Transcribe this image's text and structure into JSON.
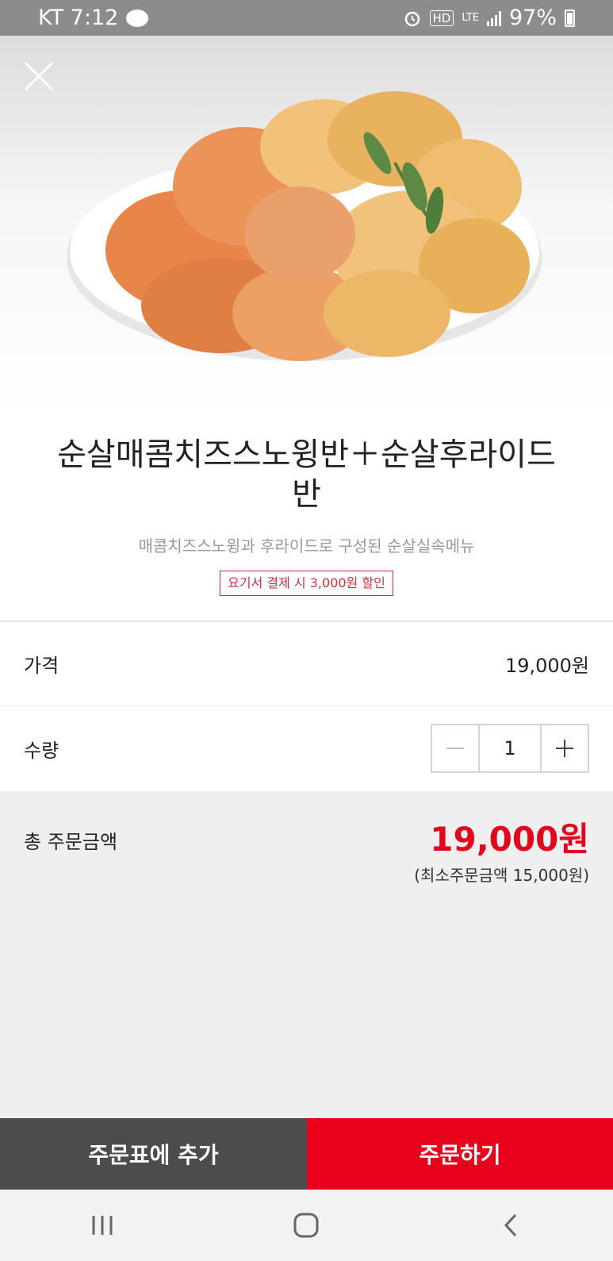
{
  "status_bar": {
    "carrier_time": "KT 7:12",
    "talk": "TALK",
    "hd": "HD",
    "lte": "LTE",
    "battery": "97%",
    "icons": [
      "talk-icon",
      "alarm-icon",
      "hd-icon",
      "lte-icon",
      "signal-icon",
      "battery-icon"
    ]
  },
  "hero": {
    "close_icon": "close-icon",
    "image": "fried-chicken-plate"
  },
  "product": {
    "title": "순살매콤치즈스노윙반＋순살후라이드반",
    "subtitle": "매콤치즈스노윙과 후라이드로 구성된 순살실속메뉴",
    "discount_badge": "요기서 결제 시 3,000원 할인"
  },
  "price_row": {
    "label": "가격",
    "value": "19,000원"
  },
  "quantity_row": {
    "label": "수량",
    "value": "1",
    "minus_icon": "minus-icon",
    "plus_icon": "plus-icon"
  },
  "total": {
    "label": "총 주문금액",
    "amount": "19,000원",
    "min_order": "(최소주문금액 15,000원)"
  },
  "actions": {
    "add_to_cart": "주문표에 추가",
    "order": "주문하기"
  },
  "colors": {
    "accent_red": "#e8011b",
    "dark_button": "#4c4c4c",
    "status_bar": "#8c8c8c"
  },
  "nav": {
    "icons": [
      "recent-apps-icon",
      "home-icon",
      "back-icon"
    ]
  }
}
